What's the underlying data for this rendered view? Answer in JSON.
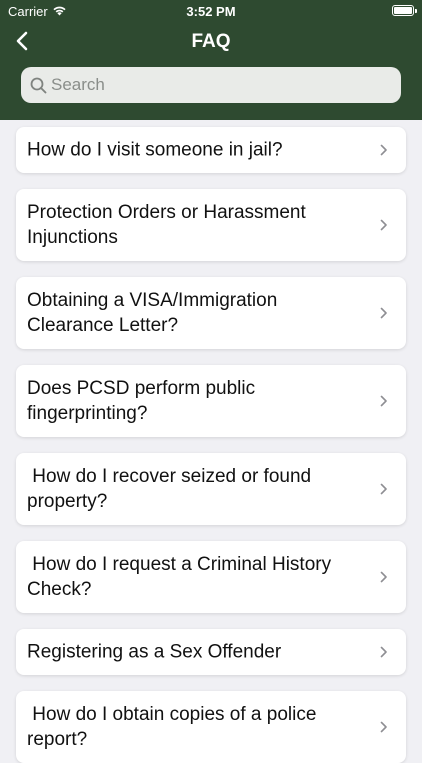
{
  "status_bar": {
    "carrier": "Carrier",
    "time": "3:52 PM"
  },
  "nav": {
    "title": "FAQ",
    "back_icon": "chevron-left-icon"
  },
  "search": {
    "placeholder": "Search",
    "value": ""
  },
  "colors": {
    "header_bg": "#2e4a30",
    "page_bg": "#f0f0f4",
    "card_bg": "#ffffff"
  },
  "faq_items": [
    {
      "label": "How do I visit someone in jail?"
    },
    {
      "label": "Protection Orders or Harassment Injunctions"
    },
    {
      "label": "Obtaining a VISA/Immigration Clearance Letter?"
    },
    {
      "label": "Does PCSD perform public fingerprinting?"
    },
    {
      "label": " How do I recover seized or found property?"
    },
    {
      "label": " How do I request a Criminal History Check?"
    },
    {
      "label": "Registering as a Sex Offender"
    },
    {
      "label": " How do I obtain copies of a police report?"
    }
  ]
}
